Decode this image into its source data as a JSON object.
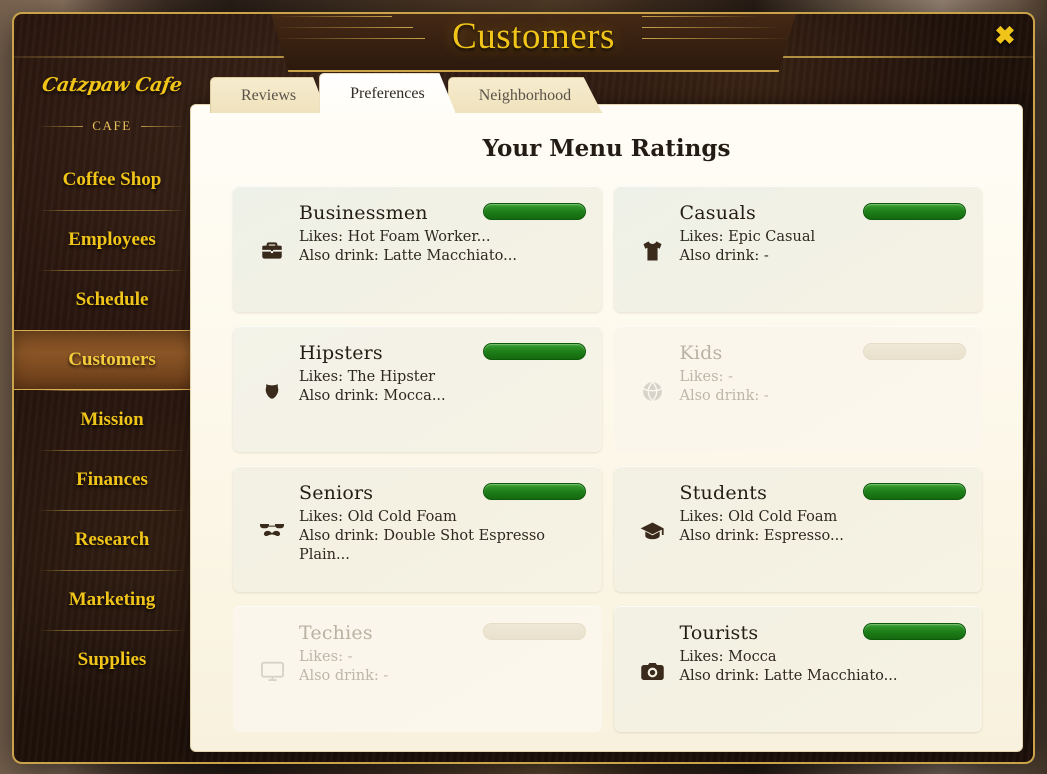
{
  "window": {
    "title": "Customers",
    "close_label": "✖"
  },
  "sidebar": {
    "logo": "Catzpaw Cafe",
    "section_label": "CAFE",
    "items": [
      {
        "label": "Coffee Shop",
        "active": false
      },
      {
        "label": "Employees",
        "active": false
      },
      {
        "label": "Schedule",
        "active": false
      },
      {
        "label": "Customers",
        "active": true
      },
      {
        "label": "Mission",
        "active": false
      },
      {
        "label": "Finances",
        "active": false
      },
      {
        "label": "Research",
        "active": false
      },
      {
        "label": "Marketing",
        "active": false
      },
      {
        "label": "Supplies",
        "active": false
      }
    ]
  },
  "tabs": [
    {
      "label": "Reviews",
      "active": false
    },
    {
      "label": "Preferences",
      "active": true
    },
    {
      "label": "Neighborhood",
      "active": false
    }
  ],
  "main": {
    "heading": "Your Menu Ratings",
    "cards": [
      {
        "name": "Businessmen",
        "likes": "Likes: Hot Foam Worker...",
        "also_drink": "Also drink: Latte Macchiato...",
        "icon": "briefcase-icon",
        "rating_filled": true,
        "disabled": false
      },
      {
        "name": "Casuals",
        "likes": "Likes: Epic Casual",
        "also_drink": "Also drink: -",
        "icon": "tshirt-icon",
        "rating_filled": true,
        "disabled": false
      },
      {
        "name": "Hipsters",
        "likes": "Likes: The Hipster",
        "also_drink": "Also drink: Mocca...",
        "icon": "beard-icon",
        "rating_filled": true,
        "disabled": false
      },
      {
        "name": "Kids",
        "likes": "Likes: -",
        "also_drink": "Also drink: -",
        "icon": "ball-icon",
        "rating_filled": false,
        "disabled": true
      },
      {
        "name": "Seniors",
        "likes": "Likes: Old Cold Foam",
        "also_drink": "Also drink: Double Shot Espresso Plain...",
        "icon": "glasses-mustache-icon",
        "rating_filled": true,
        "disabled": false
      },
      {
        "name": "Students",
        "likes": "Likes: Old Cold Foam",
        "also_drink": "Also drink: Espresso...",
        "icon": "graduation-cap-icon",
        "rating_filled": true,
        "disabled": false
      },
      {
        "name": "Techies",
        "likes": "Likes: -",
        "also_drink": "Also drink: -",
        "icon": "monitor-icon",
        "rating_filled": false,
        "disabled": true
      },
      {
        "name": "Tourists",
        "likes": "Likes: Mocca",
        "also_drink": "Also drink: Latte Macchiato...",
        "icon": "camera-icon",
        "rating_filled": true,
        "disabled": false
      }
    ]
  },
  "colors": {
    "gold": "#f0c419",
    "border_gold": "#c9a24a",
    "rating_green": "#1e8019",
    "rating_empty": "#e9e1cd",
    "panel_bg": "#fffdf6",
    "window_bg": "#2a170e"
  }
}
